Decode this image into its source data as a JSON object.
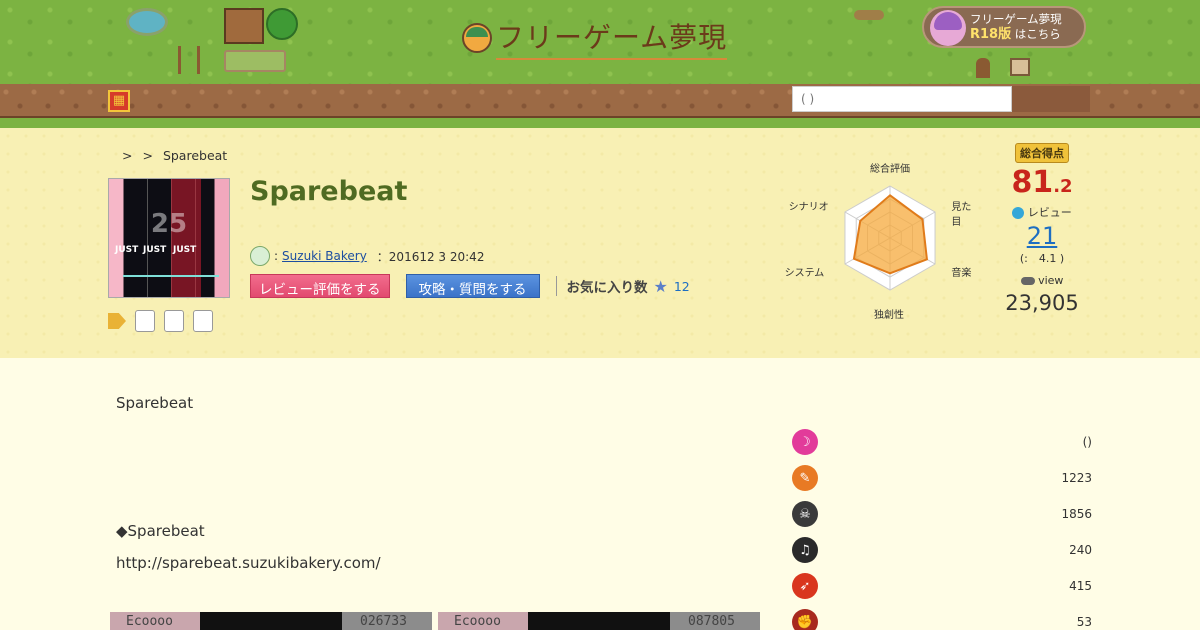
{
  "header": {
    "logo_text": "フリーゲーム夢現",
    "r18_line1": "フリーゲーム夢現",
    "r18_badge": "R18版",
    "r18_line2": "はこちら",
    "search_placeholder": "( )"
  },
  "breadcrumb": {
    "sep1": ">",
    "sep2": ">",
    "current": "Sparebeat"
  },
  "game": {
    "title": "Sparebeat",
    "dev_prefix": ":",
    "developer": "Suzuki Bakery",
    "date": "：201612 3 20:42",
    "review_button": "レビュー評価をする",
    "guide_button": "攻略・質問をする",
    "favorites_label": "お気に入り数",
    "favorites_count": "12"
  },
  "thumbnail": {
    "combo": "25",
    "judge_label": "JUST"
  },
  "radar": {
    "axes": [
      "総合評価",
      "見た目",
      "音楽",
      "独創性",
      "システム",
      "シナリオ"
    ],
    "values": [
      0.82,
      0.72,
      0.82,
      0.68,
      0.8,
      0.66
    ]
  },
  "score": {
    "badge": "総合得点",
    "integer": "81",
    "decimal": ".2",
    "review_label": "レビュー",
    "review_count": "21",
    "review_avg": "(:　4.1 )",
    "view_label": "view",
    "view_count": "23,905"
  },
  "description": {
    "line1": "Sparebeat",
    "line2": "◆Sparebeat",
    "url": "http://sparebeat.suzukibakery.com/"
  },
  "screenshots": [
    {
      "left_text": "Ecoooo",
      "right_text": "026733"
    },
    {
      "left_text": "Ecoooo",
      "right_text": "087805"
    }
  ],
  "stats": [
    {
      "icon": "moon-icon",
      "color": "#e23b9a",
      "value": "()"
    },
    {
      "icon": "feather-icon",
      "color": "#e87a24",
      "value": "1223"
    },
    {
      "icon": "monster-icon",
      "color": "#3a3a3a",
      "value": "1856"
    },
    {
      "icon": "piano-icon",
      "color": "#2a2a2a",
      "value": "240"
    },
    {
      "icon": "runner-icon",
      "color": "#d9361e",
      "value": "415"
    },
    {
      "icon": "strongman-icon",
      "color": "#a82a1e",
      "value": "53"
    }
  ]
}
